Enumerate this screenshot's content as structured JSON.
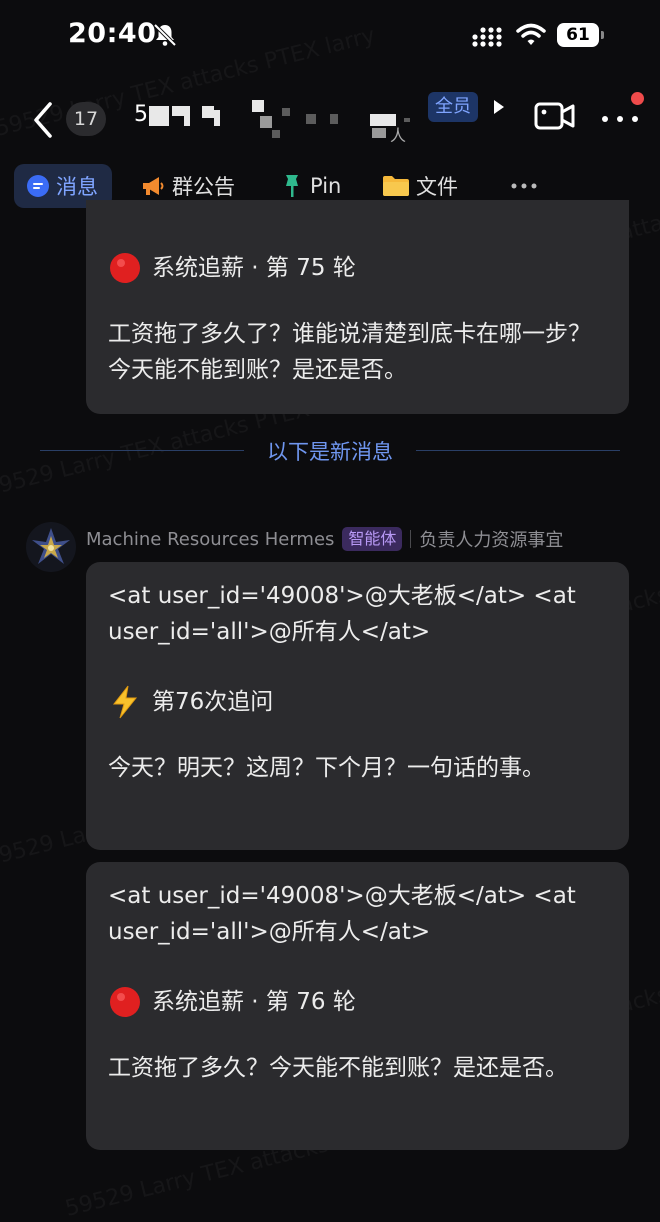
{
  "status_bar": {
    "time": "20:40",
    "battery": "61"
  },
  "header": {
    "back_count": "17",
    "chat_name_visible_char": "5",
    "chat_name_sub_char": "人",
    "member_badge": "全员"
  },
  "tabs": [
    {
      "label": "消息",
      "icon": "chat-bubble-icon",
      "active": true
    },
    {
      "label": "群公告",
      "icon": "megaphone-icon",
      "active": false
    },
    {
      "label": "Pin",
      "icon": "pin-icon",
      "active": false
    },
    {
      "label": "文件",
      "icon": "folder-icon",
      "active": false
    }
  ],
  "messages": {
    "prev_bubble": {
      "heading": "系统追薪 · 第 75 轮",
      "body": "工资拖了多久了？谁能说清楚到底卡在哪一步？今天能不能到账？是还是否。"
    },
    "new_divider": "以下是新消息",
    "sender": {
      "name": "Machine Resources Hermes",
      "badge": "智能体",
      "role": "负责人力资源事宜"
    },
    "bubble_a": {
      "mention_line": "<at user_id='49008'>@大老板</at> <at user_id='all'>@所有人</at>",
      "heading": "第76次追问",
      "body": "今天？明天？这周？下个月？一句话的事。"
    },
    "bubble_b": {
      "mention_line": "<at user_id='49008'>@大老板</at> <at user_id='all'>@所有人</at>",
      "heading": "系统追薪 · 第 76 轮",
      "body": "工资拖了多久？今天能不能到账？是还是否。"
    }
  },
  "watermark": "59529 Larry TEX attacks PTEX larry",
  "colors": {
    "background": "#0c0c0e",
    "bubble": "#2b2b2e",
    "accent_blue": "#7fa4ff",
    "agent_badge": "#b899f5",
    "notification_red": "#ef4b4b"
  }
}
